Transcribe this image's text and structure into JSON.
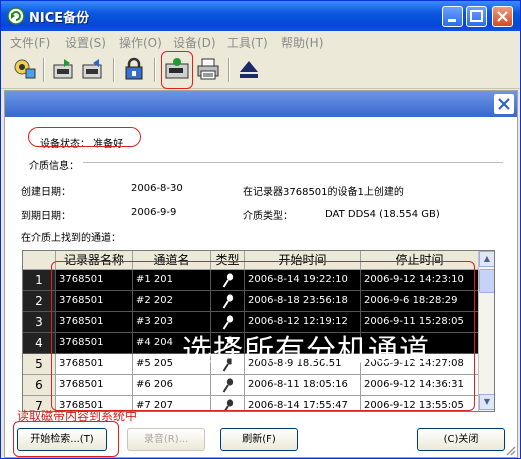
{
  "window": {
    "title": "NICE备份"
  },
  "menu": [
    "文件(F)",
    "设置(S)",
    "操作(O)",
    "设备(D)",
    "工具(T)",
    "帮助(H)"
  ],
  "toolbar": {
    "icons": [
      "connect-icon",
      "backup-icon",
      "restore-icon",
      "lock-icon",
      "tape-device-icon",
      "print-icon",
      "eject-icon"
    ]
  },
  "device": {
    "status_label": "设备状态： 准备好",
    "media_info_label": "介质信息：",
    "create_date_label": "创建日期：",
    "create_date": "2006-8-30",
    "create_note": "在记录器3768501的设备1上创建的",
    "expire_date_label": "到期日期：",
    "expire_date": "2006-9-9",
    "media_type_label": "介质类型：",
    "media_type": "DAT DDS4 (18.554 GB)",
    "found_channels_label": "在介质上找到的通道："
  },
  "table": {
    "columns": [
      "",
      "记录器名称",
      "通道名",
      "类型",
      "开始时间",
      "停止时间"
    ],
    "rows": [
      {
        "no": "1",
        "recorder": "3768501",
        "channel": "#1 201",
        "start": "2006-8-14 19:22:10",
        "stop": "2006-9-12 14:23:10",
        "selected": true
      },
      {
        "no": "2",
        "recorder": "3768501",
        "channel": "#2 202",
        "start": "2006-8-18 23:56:18",
        "stop": "2006-9-6 18:28:29",
        "selected": true
      },
      {
        "no": "3",
        "recorder": "3768501",
        "channel": "#3 203",
        "start": "2006-8-12 12:19:12",
        "stop": "2006-9-11 15:28:05",
        "selected": true
      },
      {
        "no": "4",
        "recorder": "3768501",
        "channel": "#4 204",
        "start": "",
        "stop": "",
        "selected": true
      },
      {
        "no": "5",
        "recorder": "3768501",
        "channel": "#5 205",
        "start": "2006-8-9 18:56:51",
        "stop": "2006-9-12 14:27:08",
        "selected": false
      },
      {
        "no": "6",
        "recorder": "3768501",
        "channel": "#6 206",
        "start": "2006-8-11 18:05:16",
        "stop": "2006-9-12 14:36:31",
        "selected": false
      },
      {
        "no": "7",
        "recorder": "3768501",
        "channel": "#7 207",
        "start": "2006-8-14 17:55:47",
        "stop": "2006-9-12 13:55:05",
        "selected": false
      }
    ]
  },
  "annotations": {
    "select_all": "选择所有分机通道",
    "read_tape": "读取磁带内容到系统中"
  },
  "buttons": {
    "search": "开始检索...(T)",
    "record": "录音(R)...",
    "refresh": "刷新(F)",
    "close": "(C)关闭"
  },
  "colors": {
    "title_blue": "#0a58e0",
    "selection": "#000000",
    "annotation_red": "#e0201b"
  }
}
